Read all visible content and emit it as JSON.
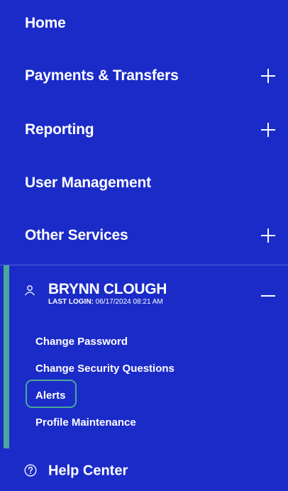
{
  "nav": {
    "items": [
      {
        "label": "Home",
        "expandable": false
      },
      {
        "label": "Payments & Transfers",
        "expandable": true
      },
      {
        "label": "Reporting",
        "expandable": true
      },
      {
        "label": "User Management",
        "expandable": false
      },
      {
        "label": "Other Services",
        "expandable": true
      }
    ]
  },
  "user": {
    "name": "BRYNN CLOUGH",
    "last_login_label": "LAST LOGIN:",
    "last_login_value": "06/17/2024 08:21 AM",
    "expanded": true,
    "submenu": [
      {
        "label": "Change Password"
      },
      {
        "label": "Change Security Questions"
      },
      {
        "label": "Alerts",
        "focused": true
      },
      {
        "label": "Profile Maintenance"
      }
    ]
  },
  "help": {
    "label": "Help Center",
    "icon": "question-circle-icon"
  },
  "icons": {
    "expand": "plus-icon",
    "collapse": "minus-icon",
    "user": "user-icon"
  },
  "colors": {
    "background": "#1b2bc8",
    "accent": "#4aa89a",
    "text": "#ffffff"
  }
}
